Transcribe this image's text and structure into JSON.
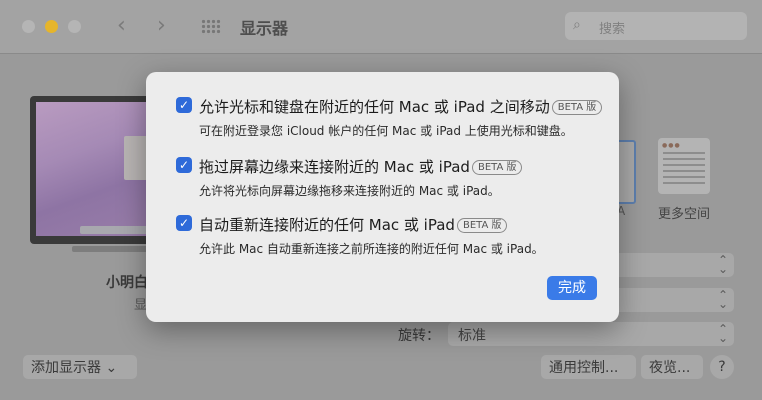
{
  "window": {
    "title": "显示器",
    "search_placeholder": "搜索",
    "nav_back": "‹",
    "nav_forward": "›"
  },
  "background": {
    "display_name": "小明白",
    "display_sub": "显",
    "more_spaces_label": "更多空间",
    "side_letter": "A",
    "rotate_label": "旋转：",
    "rotate_value": "标准",
    "add_display_button": "添加显示器 ⌄",
    "general_control_button": "通用控制...",
    "night_shift_button": "夜览...",
    "help_button": "?"
  },
  "sheet": {
    "options": [
      {
        "checked": true,
        "title": "允许光标和键盘在附近的任何 Mac 或 iPad 之间移动",
        "badge": "BETA 版",
        "description": "可在附近登录您 iCloud 帐户的任何 Mac 或 iPad 上使用光标和键盘。"
      },
      {
        "checked": true,
        "title": "拖过屏幕边缘来连接附近的 Mac 或 iPad",
        "badge": "BETA 版",
        "description": "允许将光标向屏幕边缘拖移来连接附近的 Mac 或 iPad。"
      },
      {
        "checked": true,
        "title": "自动重新连接附近的任何 Mac 或 iPad",
        "badge": "BETA 版",
        "description": "允许此 Mac 自动重新连接之前所连接的附近任何 Mac 或 iPad。"
      }
    ],
    "done_button": "完成",
    "checkmark": "✓"
  },
  "colors": {
    "accent": "#2e6ad9",
    "done_button": "#3a7be8",
    "minimize_light": "#e6b52b"
  }
}
